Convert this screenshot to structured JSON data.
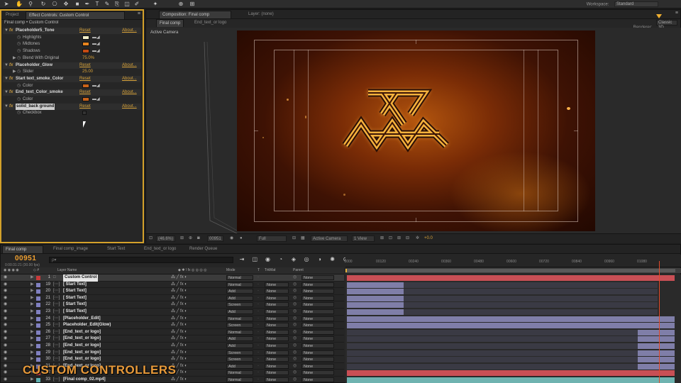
{
  "workspace": {
    "label": "Workspace:",
    "value": "Standard"
  },
  "effects_panel": {
    "tabs": [
      "Project",
      "Effect Controls: Custom Control"
    ],
    "breadcrumb": "Final comp • Custom Control",
    "reset_label": "Reset",
    "about_label": "About...",
    "effects": [
      {
        "name": "Placeholder5_Tone",
        "params": [
          {
            "label": "Highlights",
            "color": "#f4f0c8"
          },
          {
            "label": "Midtones",
            "color": "#e8851e"
          },
          {
            "label": "Shadows",
            "color": "#c44a12"
          },
          {
            "label": "Blend With Original",
            "value": "75.0%"
          }
        ]
      },
      {
        "name": "Placeholder_Glow",
        "params": [
          {
            "label": "Slider",
            "value": "25.00"
          }
        ]
      },
      {
        "name": "Start text_smoke_Color",
        "params": [
          {
            "label": "Color",
            "color": "#c8621a"
          }
        ]
      },
      {
        "name": "End_text_Color_smoke",
        "params": [
          {
            "label": "Color",
            "color": "#c8621a"
          }
        ]
      },
      {
        "name": "solid_back ground",
        "params": [
          {
            "label": "Checkbox",
            "checkbox": false
          }
        ]
      }
    ]
  },
  "comp_panel": {
    "tabs": [
      "Composition: Final comp",
      "Layer: (none)"
    ],
    "subtabs": [
      "Final comp",
      "End_text_or logo"
    ],
    "renderer_label": "Renderer:",
    "renderer_value": "Classic 3D",
    "active_camera": "Active Camera",
    "strip": {
      "zoom": "(46.6%)",
      "timecode": "00951",
      "resolution": "Full",
      "view": "Active Camera",
      "views": "1 View",
      "exposure": "+0.0"
    }
  },
  "timeline": {
    "tabs": [
      "Final comp",
      "Final comp_image",
      "Start Text",
      "End_text_or logo",
      "Render Queue"
    ],
    "timecode": "00951",
    "fps": "0:00:31:21 (30.00 fps)",
    "search_placeholder": "ρ▾",
    "columns": {
      "layer_name": "Layer Name",
      "mode": "Mode",
      "t": "T",
      "trkmat": "TrkMat",
      "parent": "Parent"
    },
    "ruler_ticks": [
      "0000",
      "00120",
      "00240",
      "00360",
      "00480",
      "00600",
      "00720",
      "00840",
      "00960",
      "01080"
    ],
    "layers": [
      {
        "num": "1",
        "name": "Custom Control",
        "mode": "Normal",
        "trkmat": "",
        "parent": "None",
        "label": "#c83a3a",
        "bar_color": "#c94f55"
      },
      {
        "num": "19",
        "name": "[ Start Text]",
        "mode": "Normal",
        "trkmat": "None",
        "parent": "None",
        "label": "#8080c0",
        "bar_color": "#7f7ea8"
      },
      {
        "num": "20",
        "name": "[ Start Text]",
        "mode": "Add",
        "trkmat": "None",
        "parent": "None",
        "label": "#8080c0",
        "bar_color": "#7f7ea8"
      },
      {
        "num": "21",
        "name": "[ Start Text]",
        "mode": "Add",
        "trkmat": "None",
        "parent": "None",
        "label": "#8080c0",
        "bar_color": "#7f7ea8"
      },
      {
        "num": "22",
        "name": "[ Start Text]",
        "mode": "Screen",
        "trkmat": "None",
        "parent": "None",
        "label": "#8080c0",
        "bar_color": "#7f7ea8"
      },
      {
        "num": "23",
        "name": "[ Start Text]",
        "mode": "Add",
        "trkmat": "None",
        "parent": "None",
        "label": "#8080c0",
        "bar_color": "#7f7ea8"
      },
      {
        "num": "24",
        "name": "[Placeholder_Edit]",
        "mode": "Normal",
        "trkmat": "None",
        "parent": "None",
        "label": "#8080c0",
        "bar_color": "#7f7ea8"
      },
      {
        "num": "25",
        "name": "Placeholder_Edit(Glow)",
        "mode": "Screen",
        "trkmat": "None",
        "parent": "None",
        "label": "#8080c0",
        "bar_color": "#7f7ea8"
      },
      {
        "num": "26",
        "name": "[End_text_or logo]",
        "mode": "Normal",
        "trkmat": "None",
        "parent": "None",
        "label": "#8080c0",
        "bar_color": "#7f7ea8"
      },
      {
        "num": "27",
        "name": "[End_text_or logo]",
        "mode": "Add",
        "trkmat": "None",
        "parent": "None",
        "label": "#8080c0",
        "bar_color": "#7f7ea8"
      },
      {
        "num": "28",
        "name": "[End_text_or logo]",
        "mode": "Add",
        "trkmat": "None",
        "parent": "None",
        "label": "#8080c0",
        "bar_color": "#7f7ea8"
      },
      {
        "num": "29",
        "name": "[End_text_or logo]",
        "mode": "Screen",
        "trkmat": "None",
        "parent": "None",
        "label": "#8080c0",
        "bar_color": "#7f7ea8"
      },
      {
        "num": "30",
        "name": "[End_text_or logo]",
        "mode": "Screen",
        "trkmat": "None",
        "parent": "None",
        "label": "#8080c0",
        "bar_color": "#7f7ea8"
      },
      {
        "num": "31",
        "name": "[End_text_or logo]",
        "mode": "Add",
        "trkmat": "None",
        "parent": "None",
        "label": "#8080c0",
        "bar_color": "#7f7ea8"
      },
      {
        "num": "32",
        "name": "",
        "mode": "Normal",
        "trkmat": "None",
        "parent": "None",
        "label": "#c83a3a",
        "bar_color": "#c94f55"
      },
      {
        "num": "33",
        "name": "[Final comp_02.mp4]",
        "mode": "Normal",
        "trkmat": "None",
        "parent": "None",
        "label": "#5fb0b0",
        "bar_color": "#6fb3b0"
      }
    ]
  },
  "brand_overlay": "CUSTOM CONTROLLERS"
}
